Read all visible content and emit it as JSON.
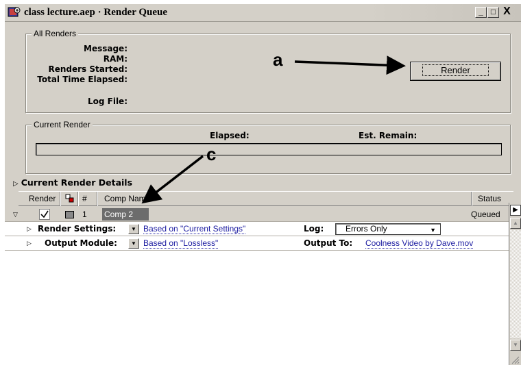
{
  "window": {
    "title": "class lecture.aep · Render Queue",
    "minimize_label": "_",
    "maximize_label": "□",
    "close_label": "X"
  },
  "all_renders": {
    "group_label": "All Renders",
    "message_label": "Message:",
    "ram_label": "RAM:",
    "renders_started_label": "Renders Started:",
    "total_time_label": "Total Time Elapsed:",
    "log_file_label": "Log File:",
    "render_button": "Render"
  },
  "current_render": {
    "group_label": "Current Render",
    "elapsed_label": "Elapsed:",
    "est_remain_label": "Est. Remain:"
  },
  "details": {
    "label": "Current Render Details"
  },
  "columns": {
    "render": "Render",
    "number": "#",
    "comp_name": "Comp Name",
    "status": "Status"
  },
  "queue_item": {
    "number": "1",
    "comp_name": "Comp 2",
    "status": "Queued",
    "render_checked": true,
    "render_settings_label": "Render Settings:",
    "render_settings_value": "Based on \"Current Settings\"",
    "log_label": "Log:",
    "log_value": "Errors Only",
    "output_module_label": "Output Module:",
    "output_module_value": "Based on \"Lossless\"",
    "output_to_label": "Output To:",
    "output_to_value": "Coolness Video by Dave.mov"
  },
  "annotations": {
    "a": "a",
    "c": "c"
  },
  "icons": {
    "app": "after-effects-app-icon",
    "expand": "triangle-right-icon",
    "collapse": "triangle-down-icon",
    "check": "checkmark-icon",
    "label_color": "label-color-icon",
    "dropdown": "dropdown-arrow-icon"
  },
  "colors": {
    "window_bg": "#d4d0c8",
    "link": "#1a1aa0",
    "selected_comp_bg": "#6c6c6c",
    "label_swatch": "#888888"
  }
}
